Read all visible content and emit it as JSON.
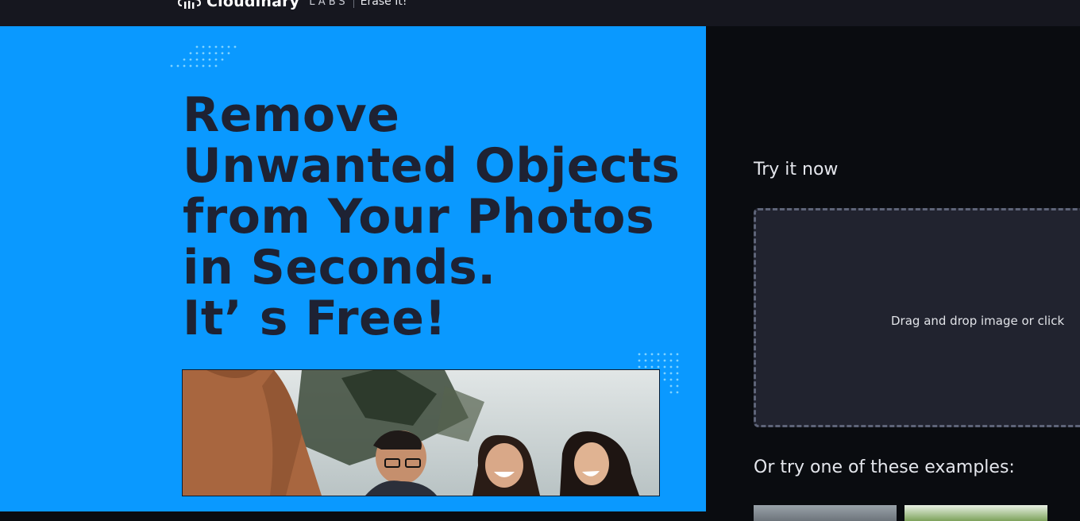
{
  "header": {
    "brand_name": "Cloudinary",
    "brand_suffix": "LABS",
    "product_name": "Erase It!",
    "logo_icon": "cloudinary-logo-icon"
  },
  "hero": {
    "headline_lines": [
      "Remove",
      "Unwanted Objects",
      "from Your Photos",
      "in Seconds.",
      "It’ s Free!"
    ],
    "background_color": "#0a99ff",
    "headline_color": "#1e2233"
  },
  "try_panel": {
    "title": "Try it now",
    "dropzone_text": "Drag and drop image or click",
    "examples_title": "Or try one of these examples:"
  },
  "colors": {
    "panel_background": "#0a0c10",
    "dropzone_background": "#21232f",
    "dropzone_border": "#5e6478",
    "accent_dots": "#7fd2ff"
  }
}
